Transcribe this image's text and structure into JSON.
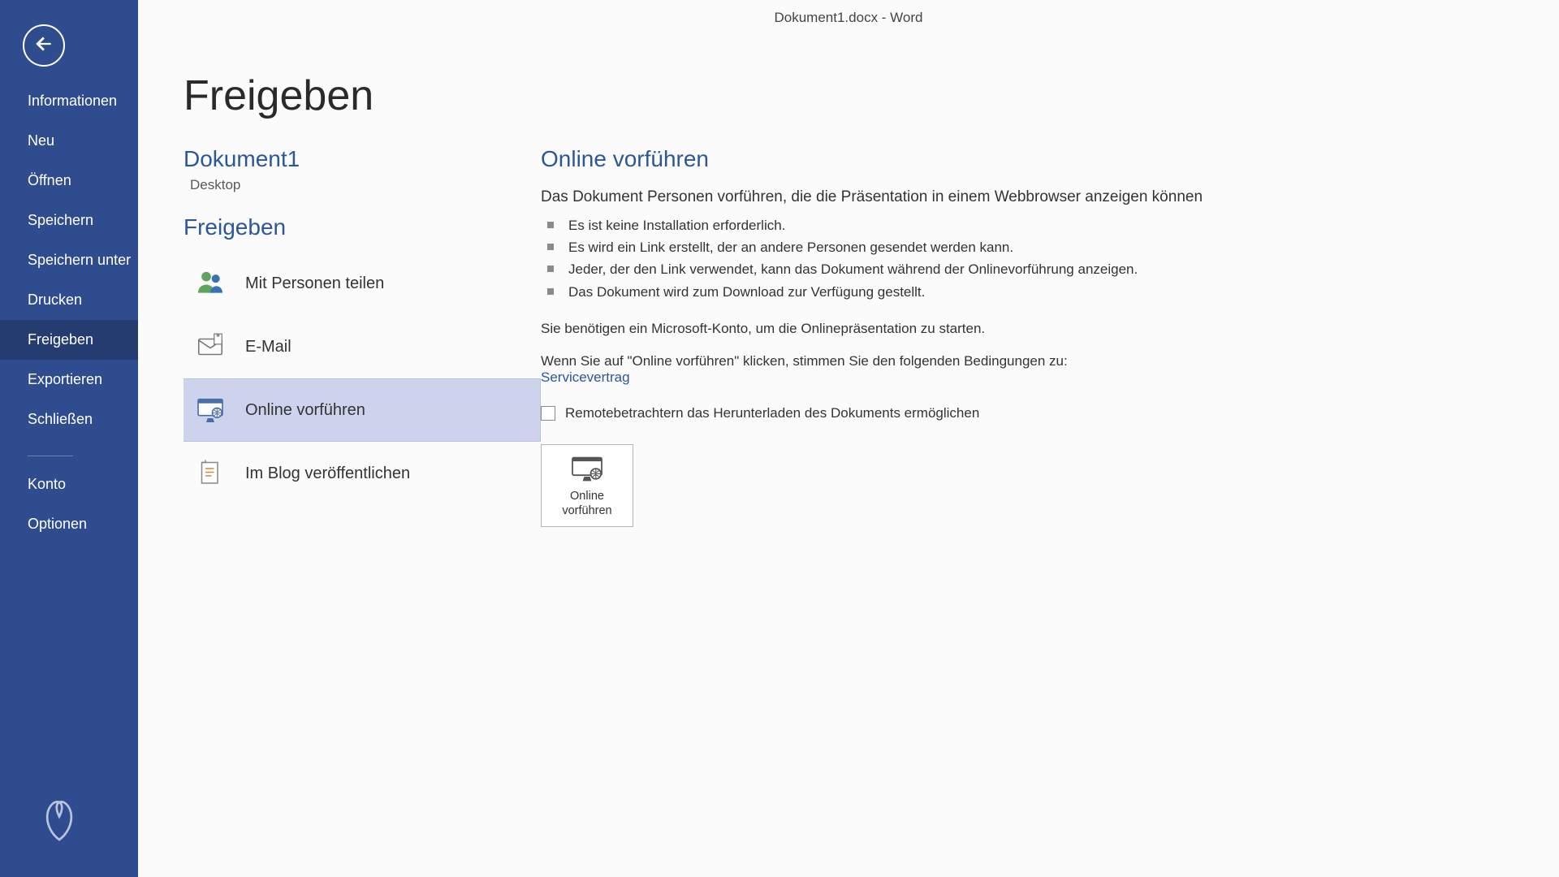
{
  "window": {
    "title": "Dokument1.docx - Word"
  },
  "sidebar": {
    "items": [
      {
        "label": "Informationen"
      },
      {
        "label": "Neu"
      },
      {
        "label": "Öffnen"
      },
      {
        "label": "Speichern"
      },
      {
        "label": "Speichern unter"
      },
      {
        "label": "Drucken"
      },
      {
        "label": "Freigeben"
      },
      {
        "label": "Exportieren"
      },
      {
        "label": "Schließen"
      }
    ],
    "footer_items": [
      {
        "label": "Konto"
      },
      {
        "label": "Optionen"
      }
    ]
  },
  "share_panel": {
    "page_title": "Freigeben",
    "document_name": "Dokument1",
    "document_location": "Desktop",
    "section_title": "Freigeben",
    "options": [
      {
        "icon": "people-icon",
        "label": "Mit Personen teilen"
      },
      {
        "icon": "email-icon",
        "label": "E-Mail"
      },
      {
        "icon": "present-online-icon",
        "label": "Online vorführen"
      },
      {
        "icon": "blog-icon",
        "label": "Im Blog veröffentlichen"
      }
    ],
    "selected_index": 2
  },
  "detail": {
    "title": "Online vorführen",
    "lead": "Das Dokument Personen vorführen, die die Präsentation in einem Webbrowser anzeigen können",
    "bullets": [
      "Es ist keine Installation erforderlich.",
      "Es wird ein Link erstellt, der an andere Personen gesendet werden kann.",
      "Jeder, der den Link verwendet, kann das Dokument während der Onlinevorführung anzeigen.",
      "Das Dokument wird zum Download zur Verfügung gestellt."
    ],
    "note": "Sie benötigen ein Microsoft-Konto, um die Onlinepräsentation zu starten.",
    "agree_text": "Wenn Sie auf \"Online vorführen\" klicken, stimmen Sie den folgenden Bedingungen zu:",
    "link_text": "Servicevertrag",
    "checkbox_label": "Remotebetrachtern das Herunterladen des Dokuments ermöglichen",
    "checkbox_checked": false,
    "action_button_label": "Online vorführen"
  }
}
